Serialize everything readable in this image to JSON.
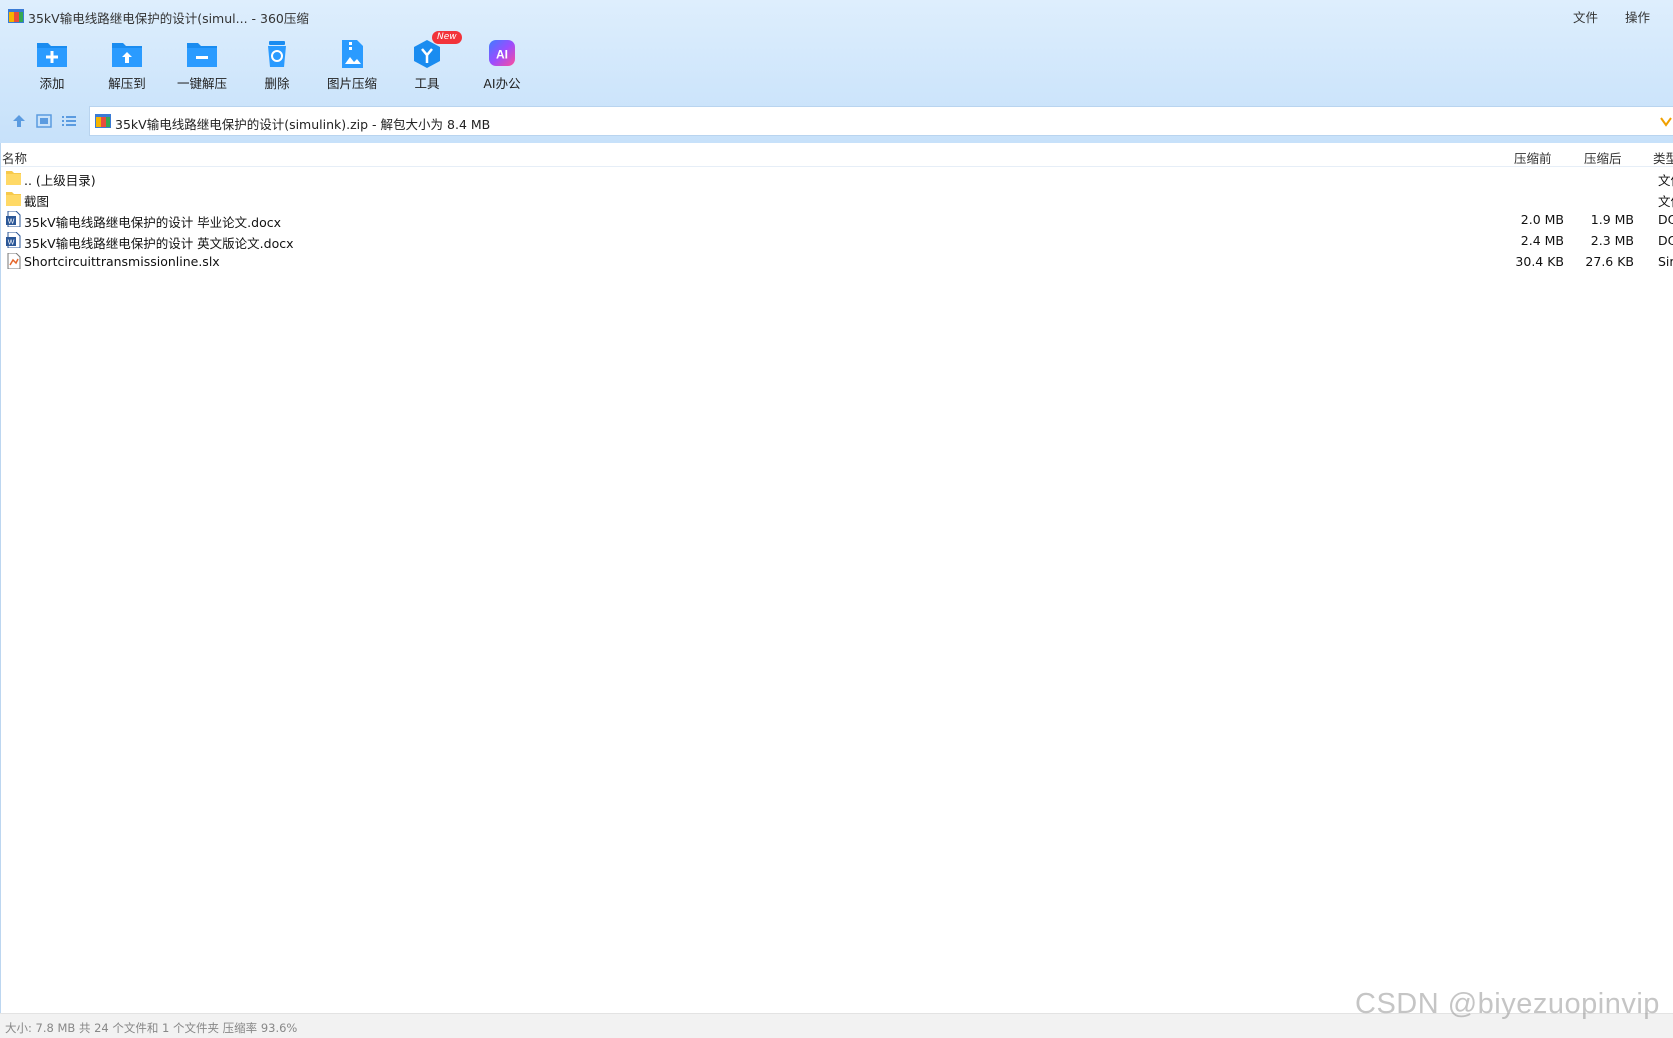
{
  "window": {
    "title": "35kV输电线路继电保护的设计(simul... - 360压缩",
    "menu": {
      "file": "文件",
      "ops": "操作"
    }
  },
  "toolbar": {
    "add": "添加",
    "extract_to": "解压到",
    "one_click_extract": "一键解压",
    "delete": "删除",
    "image_compress": "图片压缩",
    "tools": "工具",
    "tools_badge": "New",
    "ai_office": "AI办公",
    "ai_icon_text": "AI"
  },
  "address": {
    "path": "35kV输电线路继电保护的设计(simulink).zip - 解包大小为 8.4 MB"
  },
  "columns": {
    "name": "名称",
    "before": "压缩前",
    "after": "压缩后",
    "type": "类型"
  },
  "files": [
    {
      "name": ".. (上级目录)",
      "size": "",
      "packed": "",
      "type": "文件夹",
      "icon": "folder-icon"
    },
    {
      "name": "截图",
      "size": "",
      "packed": "",
      "type": "文件夹",
      "icon": "folder-icon"
    },
    {
      "name": "35kV输电线路继电保护的设计 毕业论文.docx",
      "size": "2.0 MB",
      "packed": "1.9 MB",
      "type": "DOCX",
      "icon": "word-doc-icon"
    },
    {
      "name": "35kV输电线路继电保护的设计 英文版论文.docx",
      "size": "2.4 MB",
      "packed": "2.3 MB",
      "type": "DOCX",
      "icon": "word-doc-icon"
    },
    {
      "name": "Shortcircuittransmissionline.slx",
      "size": "30.4 KB",
      "packed": "27.6 KB",
      "type": "Simulink",
      "icon": "simulink-file-icon"
    }
  ],
  "status": "大小: 7.8 MB 共 24 个文件和 1 个文件夹 压缩率 93.6%",
  "watermark": "CSDN @biyezuopinvip",
  "colors": {
    "accent": "#1a8cf0",
    "band": "#d4e8fc",
    "badge": "#f2333a"
  }
}
